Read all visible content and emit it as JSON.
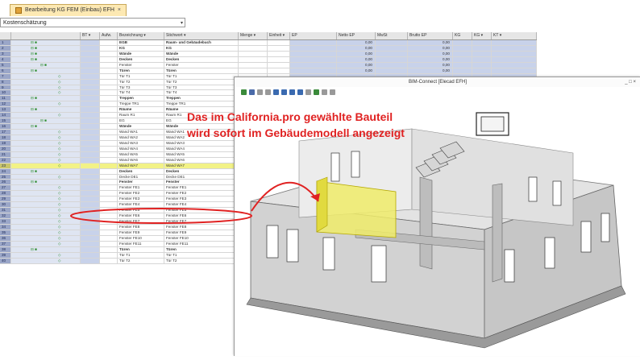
{
  "window": {
    "tab_title": "Bearbeitung KG FEM (Einbau) EFH",
    "tab_close": "×",
    "dropdown_value": "Kostenschätzung",
    "dropdown_arrow": "▾"
  },
  "grid": {
    "columns": [
      "",
      "",
      "BT ▾",
      "Aufw.",
      "Bezeichnung ▾",
      "Stichwort ▾",
      "Menge ▾",
      "Einheit ▾",
      "EP",
      "Netto EP",
      "MwSt",
      "Brutto EP",
      "KG",
      "KG ▾",
      "KT ▾"
    ],
    "rows": [
      {
        "idx": "1",
        "tree": "⊟ ■",
        "b": "EGB",
        "s": "Raum- und Gebäudebuch",
        "v1": "0,00",
        "v2": "0,00",
        "group": true
      },
      {
        "idx": "2",
        "tree": "⊟ ■",
        "b": "KG",
        "s": "KG",
        "v1": "0,00",
        "v2": "0,00",
        "group": true
      },
      {
        "idx": "3",
        "tree": "⊟ ■",
        "b": "Wände",
        "s": "Wände",
        "v1": "0,00",
        "v2": "0,00",
        "group": true
      },
      {
        "idx": "4",
        "tree": "⊟ ■",
        "b": "Decken",
        "s": "Decken",
        "v1": "0,00",
        "v2": "0,00",
        "group": true
      },
      {
        "idx": "5",
        "tree": "⊟ ■",
        "b": "Fenster",
        "s": "Fenster",
        "v1": "0,00",
        "v2": "0,00",
        "group": false
      },
      {
        "idx": "6",
        "tree": "⊟ ■",
        "b": "Türen",
        "s": "Türen",
        "v1": "0,00",
        "v2": "0,00",
        "group": true
      },
      {
        "idx": "7",
        "tree": "◇",
        "b": "Tür T1",
        "s": "Tür T1",
        "v1": "",
        "v2": "",
        "group": false
      },
      {
        "idx": "8",
        "tree": "◇",
        "b": "Tür T2",
        "s": "Tür T2",
        "v1": "",
        "v2": "",
        "group": false
      },
      {
        "idx": "9",
        "tree": "◇",
        "b": "Tür T3",
        "s": "Tür T3",
        "v1": "",
        "v2": "",
        "group": false
      },
      {
        "idx": "10",
        "tree": "◇",
        "b": "Tür T4",
        "s": "Tür T4",
        "v1": "",
        "v2": "",
        "group": false
      },
      {
        "idx": "11",
        "tree": "⊟ ■",
        "b": "Treppen",
        "s": "Treppen",
        "v1": "",
        "v2": "",
        "group": true
      },
      {
        "idx": "12",
        "tree": "◇",
        "b": "Treppe TR1",
        "s": "Treppe TR1",
        "v1": "",
        "v2": "",
        "group": false
      },
      {
        "idx": "13",
        "tree": "⊟ ■",
        "b": "Räume",
        "s": "Räume",
        "v1": "",
        "v2": "",
        "group": true
      },
      {
        "idx": "14",
        "tree": "◇",
        "b": "Raum R1",
        "s": "Raum R1",
        "v1": "",
        "v2": "",
        "group": false
      },
      {
        "idx": "15",
        "tree": "⊟ ■",
        "b": "EG",
        "s": "EG",
        "v1": "",
        "v2": "",
        "group": false
      },
      {
        "idx": "16",
        "tree": "⊟ ■",
        "b": "Wände",
        "s": "Wände",
        "v1": "",
        "v2": "",
        "group": true
      },
      {
        "idx": "17",
        "tree": "◇",
        "b": "Wand WA1",
        "s": "Wand WA1",
        "v1": "",
        "v2": "",
        "group": false
      },
      {
        "idx": "18",
        "tree": "◇",
        "b": "Wand WA2",
        "s": "Wand WA2",
        "v1": "",
        "v2": "",
        "group": false
      },
      {
        "idx": "19",
        "tree": "◇",
        "b": "Wand WA3",
        "s": "Wand WA3",
        "v1": "",
        "v2": "",
        "group": false
      },
      {
        "idx": "20",
        "tree": "◇",
        "b": "Wand WA4",
        "s": "Wand WA4",
        "v1": "",
        "v2": "",
        "group": false
      },
      {
        "idx": "21",
        "tree": "◇",
        "b": "Wand WA5",
        "s": "Wand WA5",
        "v1": "",
        "v2": "",
        "group": false
      },
      {
        "idx": "22",
        "tree": "◇",
        "b": "Wand WA6",
        "s": "Wand WA6",
        "v1": "",
        "v2": "",
        "group": false
      },
      {
        "idx": "23",
        "tree": "◇",
        "b": "Wand WA7",
        "s": "Wand WA7",
        "v1": "",
        "v2": "",
        "group": false,
        "hl": true
      },
      {
        "idx": "24",
        "tree": "⊟ ■",
        "b": "Decken",
        "s": "Decken",
        "v1": "",
        "v2": "",
        "group": true
      },
      {
        "idx": "25",
        "tree": "◇",
        "b": "Decke DE1",
        "s": "Decke DE1",
        "v1": "",
        "v2": "",
        "group": false
      },
      {
        "idx": "26",
        "tree": "⊟ ■",
        "b": "Fenster",
        "s": "Fenster",
        "v1": "",
        "v2": "",
        "group": true
      },
      {
        "idx": "27",
        "tree": "◇",
        "b": "Fenster FE1",
        "s": "Fenster FE1",
        "v1": "",
        "v2": "",
        "group": false
      },
      {
        "idx": "28",
        "tree": "◇",
        "b": "Fenster FE2",
        "s": "Fenster FE2",
        "v1": "",
        "v2": "",
        "group": false
      },
      {
        "idx": "29",
        "tree": "◇",
        "b": "Fenster FE3",
        "s": "Fenster FE3",
        "v1": "",
        "v2": "",
        "group": false
      },
      {
        "idx": "30",
        "tree": "◇",
        "b": "Fenster FE4",
        "s": "Fenster FE4",
        "v1": "",
        "v2": "",
        "group": false
      },
      {
        "idx": "31",
        "tree": "◇",
        "b": "Fenster FE5",
        "s": "Fenster FE5",
        "v1": "",
        "v2": "",
        "group": false
      },
      {
        "idx": "32",
        "tree": "◇",
        "b": "Fenster FE6",
        "s": "Fenster FE6",
        "v1": "",
        "v2": "",
        "group": false
      },
      {
        "idx": "33",
        "tree": "◇",
        "b": "Fenster FE7",
        "s": "Fenster FE7",
        "v1": "",
        "v2": "",
        "group": false
      },
      {
        "idx": "34",
        "tree": "◇",
        "b": "Fenster FE8",
        "s": "Fenster FE8",
        "v1": "",
        "v2": "",
        "group": false
      },
      {
        "idx": "35",
        "tree": "◇",
        "b": "Fenster FE9",
        "s": "Fenster FE9",
        "v1": "",
        "v2": "",
        "group": false
      },
      {
        "idx": "36",
        "tree": "◇",
        "b": "Fenster FE10",
        "s": "Fenster FE10",
        "v1": "",
        "v2": "",
        "group": false
      },
      {
        "idx": "37",
        "tree": "◇",
        "b": "Fenster FE11",
        "s": "Fenster FE11",
        "v1": "",
        "v2": "",
        "group": false
      },
      {
        "idx": "38",
        "tree": "⊟ ■",
        "b": "Türen",
        "s": "Türen",
        "v1": "",
        "v2": "",
        "group": true
      },
      {
        "idx": "39",
        "tree": "◇",
        "b": "Tür T1",
        "s": "Tür T1",
        "v1": "",
        "v2": "",
        "group": false
      },
      {
        "idx": "40",
        "tree": "◇",
        "b": "Tür T2",
        "s": "Tür T2",
        "v1": "",
        "v2": "",
        "group": false
      }
    ]
  },
  "bim": {
    "title": "BIM-Connect [Elecad EFH]",
    "window_controls": "_ □ ×"
  },
  "annotation": {
    "line1": "Das im California.pro gewählte Bauteil",
    "line2": "wird sofort im Gebäudemodell angezeigt"
  },
  "colors": {
    "highlight_row": "#f2f287",
    "highlight_wall": "#f0ec6a",
    "annotation_red": "#e02222",
    "index_column": "#9aa6c8"
  }
}
